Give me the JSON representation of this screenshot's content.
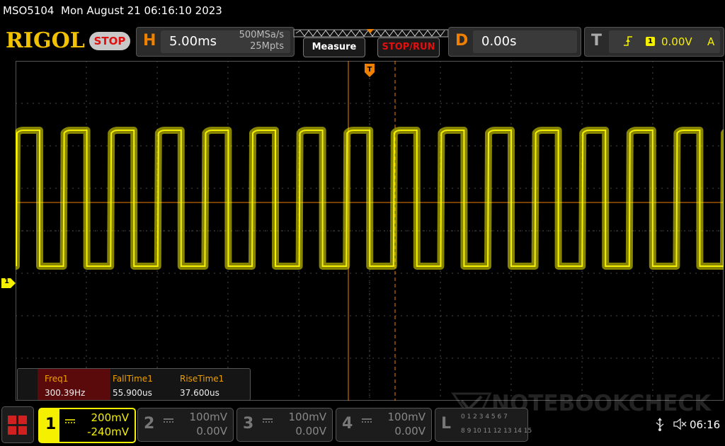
{
  "title_bar": {
    "model": "MSO5104",
    "datetime": "Mon August 21 06:16:10 2023"
  },
  "brand": {
    "logo": "RIGOL",
    "state": "STOP"
  },
  "horizontal": {
    "letter": "H",
    "timebase": "5.00ms",
    "sample_rate": "500MSa/s",
    "memory_depth": "25Mpts"
  },
  "buttons": {
    "measure": "Measure",
    "stop_run": "STOP/RUN"
  },
  "delay": {
    "letter": "D",
    "value": "0.00s"
  },
  "trigger": {
    "letter": "T",
    "source": "1",
    "level": "0.00V",
    "mode": "A"
  },
  "screen": {
    "trigger_marker": "T",
    "channel_marker": "1"
  },
  "measurements": {
    "headers": [
      "Freq1",
      "FallTime1",
      "RiseTime1"
    ],
    "values": [
      "300.39Hz",
      "55.900us",
      "37.600us"
    ]
  },
  "channels": [
    {
      "num": "1",
      "scale": "200mV",
      "offset": "-240mV",
      "active": true
    },
    {
      "num": "2",
      "scale": "100mV",
      "offset": "0.00V",
      "active": false
    },
    {
      "num": "3",
      "scale": "100mV",
      "offset": "0.00V",
      "active": false
    },
    {
      "num": "4",
      "scale": "100mV",
      "offset": "0.00V",
      "active": false
    }
  ],
  "logic": {
    "letter": "L",
    "row1": "0 1 2 3 4 5 6 7",
    "row2": "8 9 10 11 12 13 14 15"
  },
  "status": {
    "time": "06:16"
  },
  "watermark": "NOTEBOOKCHECK",
  "colors": {
    "ch1": "#f5f000",
    "accent": "#f08000",
    "stop": "#e01010"
  }
}
